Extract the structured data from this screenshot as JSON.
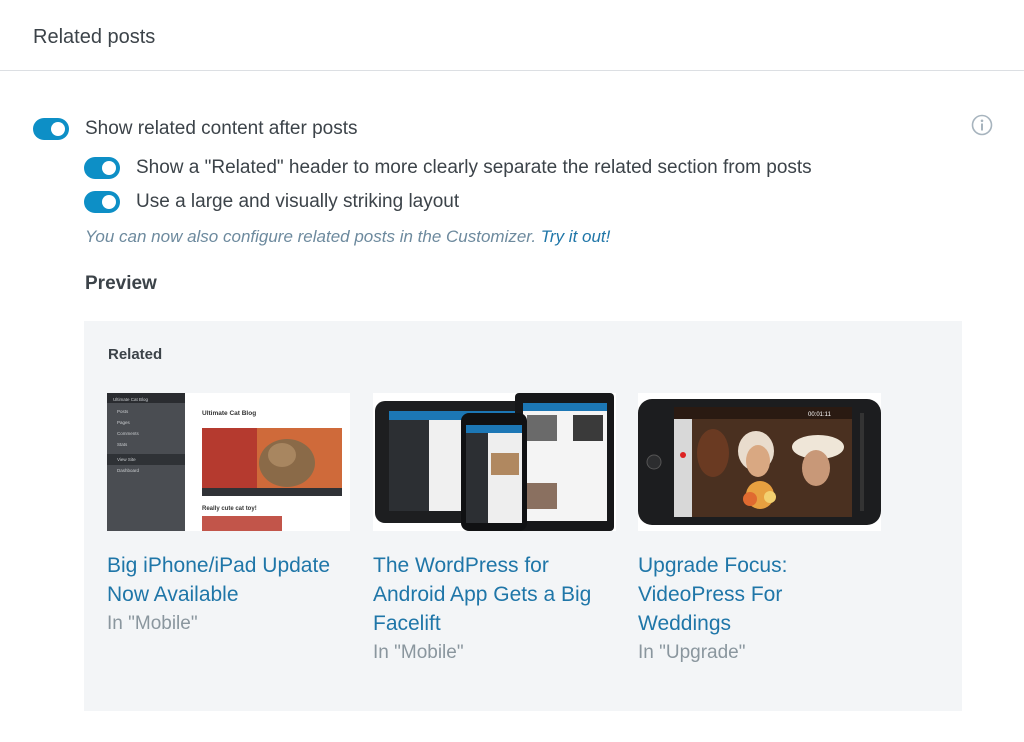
{
  "header": {
    "title": "Related posts"
  },
  "options": {
    "main_label": "Show related content after posts",
    "header_label": "Show a \"Related\" header to more clearly separate the related section from posts",
    "layout_label": "Use a large and visually striking layout",
    "note_text": "You can now also configure related posts in the Customizer. ",
    "note_link": "Try it out!"
  },
  "preview": {
    "label": "Preview",
    "related_header": "Related",
    "cards": [
      {
        "title": "Big iPhone/iPad Update Now Available",
        "category": "In \"Mobile\"",
        "thumb_icon": "wordpress-dashboard-screenshot"
      },
      {
        "title": "The WordPress for Android App Gets a Big Facelift",
        "category": "In \"Mobile\"",
        "thumb_icon": "android-devices-photo"
      },
      {
        "title": "Upgrade Focus: VideoPress For Weddings",
        "category": "In \"Upgrade\"",
        "thumb_icon": "iphone-video-photo"
      }
    ],
    "thumb_text": {
      "blog_title": "Ultimate Cat Blog",
      "post_title": "Really cute cat toy!",
      "sidebar_items": [
        "Ultimate Cat Blog",
        "Posts",
        "Pages",
        "Comments",
        "Stats",
        "View Site",
        "Dashboard"
      ],
      "video_time": "00:01:11"
    }
  },
  "colors": {
    "accent": "#0d8fc6",
    "link": "#1f76a8",
    "preview_bg": "#f3f5f7"
  }
}
